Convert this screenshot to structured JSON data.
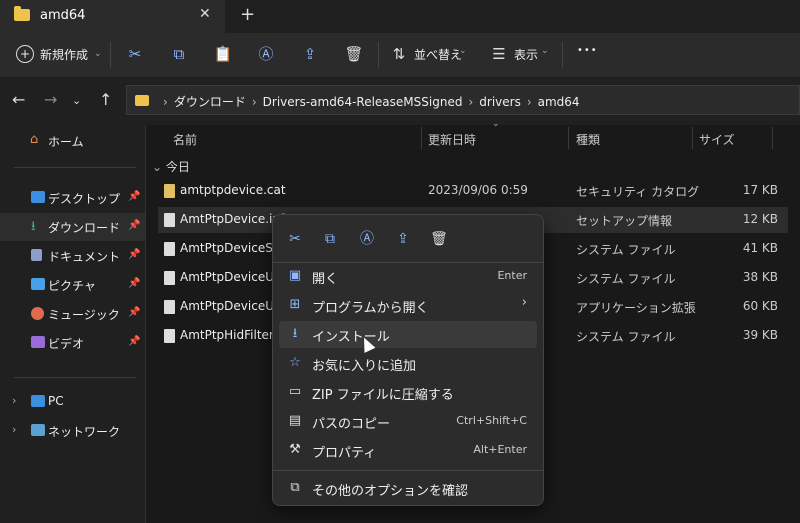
{
  "tab": {
    "title": "amd64",
    "close": "✕",
    "new": "+"
  },
  "toolbar": {
    "new_label": "新規作成",
    "sort_label": "並べ替え",
    "view_label": "表示",
    "more": "•••"
  },
  "address": {
    "crumbs": [
      "ダウンロード",
      "Drivers-amd64-ReleaseMSSigned",
      "drivers",
      "amd64"
    ]
  },
  "sidebar": {
    "home": "ホーム",
    "items": [
      {
        "label": "デスクトップ",
        "icon": "desktop-icon",
        "color": "#3b8ee0"
      },
      {
        "label": "ダウンロード",
        "icon": "download-icon",
        "color": "#3ab0a0"
      },
      {
        "label": "ドキュメント",
        "icon": "document-icon",
        "color": "#8aa0c8"
      },
      {
        "label": "ピクチャ",
        "icon": "pictures-icon",
        "color": "#4aa0e8"
      },
      {
        "label": "ミュージック",
        "icon": "music-icon",
        "color": "#e06a50"
      },
      {
        "label": "ビデオ",
        "icon": "video-icon",
        "color": "#9a6ad8"
      }
    ],
    "pc": "PC",
    "network": "ネットワーク"
  },
  "columns": {
    "name": "名前",
    "date": "更新日時",
    "type": "種類",
    "size": "サイズ"
  },
  "group": "今日",
  "files": [
    {
      "name": "amtptpdevice.cat",
      "date": "2023/09/06 0:59",
      "type": "セキュリティ カタログ",
      "size": "17 KB"
    },
    {
      "name": "AmtPtpDevice.inf",
      "date": "",
      "type": "セットアップ情報",
      "size": "12 KB"
    },
    {
      "name": "AmtPtpDeviceSpiKm",
      "date": "",
      "type": "システム ファイル",
      "size": "41 KB"
    },
    {
      "name": "AmtPtpDeviceUsbKm",
      "date": "",
      "type": "システム ファイル",
      "size": "38 KB"
    },
    {
      "name": "AmtPtpDeviceUsbUm",
      "date": "",
      "type": "アプリケーション拡張",
      "size": "60 KB"
    },
    {
      "name": "AmtPtpHidFilter.sys",
      "date": "",
      "type": "システム ファイル",
      "size": "39 KB"
    }
  ],
  "menu": {
    "items": [
      {
        "label": "開く",
        "shortcut": "Enter",
        "icon": "open-icon"
      },
      {
        "label": "プログラムから開く",
        "shortcut": "›",
        "icon": "open-with-icon"
      },
      {
        "label": "インストール",
        "shortcut": "",
        "icon": "install-icon"
      },
      {
        "label": "お気に入りに追加",
        "shortcut": "",
        "icon": "star-icon"
      },
      {
        "label": "ZIP ファイルに圧縮する",
        "shortcut": "",
        "icon": "zip-icon"
      },
      {
        "label": "パスのコピー",
        "shortcut": "Ctrl+Shift+C",
        "icon": "copy-path-icon"
      },
      {
        "label": "プロパティ",
        "shortcut": "Alt+Enter",
        "icon": "properties-icon"
      }
    ],
    "other": "その他のオプションを確認"
  }
}
